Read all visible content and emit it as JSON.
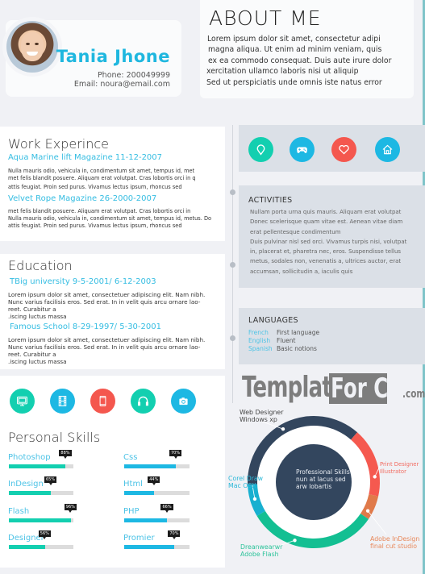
{
  "profile": {
    "name": "Tania Jhone",
    "phone": "Phone: 200049999",
    "email": "Email: noura@email.com"
  },
  "about": {
    "title": "ABOUT ME",
    "lines": [
      "Lorem ipsum dolor sit amet, consectetur adipi",
      "magna aliqua. Ut enim ad minim veniam, quis",
      "ex ea commodo consequat. Duis aute irure dolor",
      "xercitation ullamco laboris nisi ut aliquip",
      "Sed ut perspiciatis unde omnis iste natus error"
    ]
  },
  "work": {
    "title": "Work Experince",
    "jobs": [
      {
        "title": "Aqua Marine lift Magazine 11-12-2007",
        "lines": [
          "Nulla mauris odio, vehicula in, condimentum sit amet, tempus id, met",
          "met felis blandit posuere. Aliquam erat volutpat. Cras lobortis orci in q",
          "attis feugiat. Proin sed purus. Vivamus lectus ipsum, rhoncus sed"
        ]
      },
      {
        "title": "Velvet Rope Magazine 26-2000-2007",
        "lines": [
          "met felis blandit posuere. Aliquam erat volutpat. Cras lobortis orci in",
          "Nulla mauris odio, vehicula in, condimentum sit amet, tempus id, metus. Do",
          "attis feugiat. Proin sed purus. Vivamus lectus ipsum, rhoncus sed"
        ]
      }
    ]
  },
  "education": {
    "title": "Education",
    "schools": [
      {
        "title": "TBig university 9-5-2001/ 6-12-2003",
        "lines": [
          "Lorem ipsum dolor sit amet, consectetuer adipiscing elit. Nam nibh.",
          "Nunc varius facilisis eros. Sed erat. In in velit quis arcu ornare lao-",
          "reet. Curabitur a",
          ".iscing luctus massa"
        ]
      },
      {
        "title": "Famous School 8-29-1997/ 5-30-2001",
        "lines": [
          "Lorem ipsum dolor sit amet, consectetuer adipiscing elit. Nam nibh.",
          "Nunc varius facilisis eros. Sed erat. In in velit quis arcu ornare lao-",
          "reet. Curabitur a",
          ".iscing luctus massa"
        ]
      }
    ]
  },
  "skill_icons": [
    {
      "icon": "monitor-icon",
      "color": "#13cfb0"
    },
    {
      "icon": "film-icon",
      "color": "#1db8e3"
    },
    {
      "icon": "tablet-icon",
      "color": "#f4574e"
    },
    {
      "icon": "headphones-icon",
      "color": "#13cfb0"
    },
    {
      "icon": "camera-icon",
      "color": "#1db8e3"
    }
  ],
  "personal_skills": {
    "title": "Personal Skills",
    "left": [
      {
        "name": "Photoshop",
        "percent": 88,
        "label": "88%"
      },
      {
        "name": "InDesign",
        "percent": 65,
        "label": "65%"
      },
      {
        "name": "Flash",
        "percent": 96,
        "label": "96%"
      },
      {
        "name": "Designer",
        "percent": 56,
        "label": "56%"
      }
    ],
    "right": [
      {
        "name": "Css",
        "percent": 79,
        "label": "70%"
      },
      {
        "name": "Html",
        "percent": 46,
        "label": "44%"
      },
      {
        "name": "PHP",
        "percent": 66,
        "label": "66%"
      },
      {
        "name": "Promier",
        "percent": 77,
        "label": "70%"
      }
    ],
    "left_color": "#13cfb0",
    "right_color": "#1db8e3"
  },
  "hobby_icons": [
    {
      "icon": "map-pin-icon",
      "color": "#13cfb0"
    },
    {
      "icon": "gamepad-icon",
      "color": "#1db8e3"
    },
    {
      "icon": "heart-icon",
      "color": "#f4574e"
    },
    {
      "icon": "home-icon",
      "color": "#1db8e3"
    }
  ],
  "activities": {
    "title": "ACTIVITIES",
    "lines": [
      "Nullam porta urna quis mauris. Aliquam erat volutpat",
      "Donec scelerisque quam vitae est. Aenean vitae diam",
      "erat pellentesque condimentum",
      "Duis pulvinar nisl sed orci. Vivamus turpis nisi, volutpat",
      "in, placerat et, pharetra nec, eros. Suspendisse tellus",
      "metus, sodales non, venenatis a, ultrices auctor, erat",
      "accumsan, sollicitudin a, iaculis quis"
    ]
  },
  "languages": {
    "title": "LANGUAGES",
    "items": [
      {
        "name": "French",
        "level": "First language"
      },
      {
        "name": "English",
        "level": "Fluent"
      },
      {
        "name": "Spanish",
        "level": "Basic notions"
      }
    ]
  },
  "watermark": {
    "part1": "Templates",
    "part2": "For CV",
    "part3": ".com"
  },
  "professional_skills": {
    "center_lines": [
      "Professional Skills",
      "nun at lacus sed",
      "arw lobartis"
    ],
    "segments": [
      {
        "label1": "Web Designer",
        "label2": "Windows xp",
        "share": 0.37,
        "color": "#33465e",
        "label_color": "#444444"
      },
      {
        "label1": "Print Designer",
        "label2": "Illustrator",
        "share": 0.17,
        "color": "#f5594f",
        "label_color": "#f26b60"
      },
      {
        "label1": "Adobe InDesign",
        "label2": "final cut studio",
        "share": 0.06,
        "color": "#e07a4a",
        "label_color": "#e8885a"
      },
      {
        "label1": "Dreanwearwr",
        "label2": "Adobe Flash",
        "share": 0.32,
        "color": "#13bf92",
        "label_color": "#2cc39a"
      },
      {
        "label1": "Corel Draw",
        "label2": "Mac OSX",
        "share": 0.08,
        "color": "#18b0d0",
        "label_color": "#2bb8d8"
      }
    ],
    "center_color": "#33465e"
  }
}
